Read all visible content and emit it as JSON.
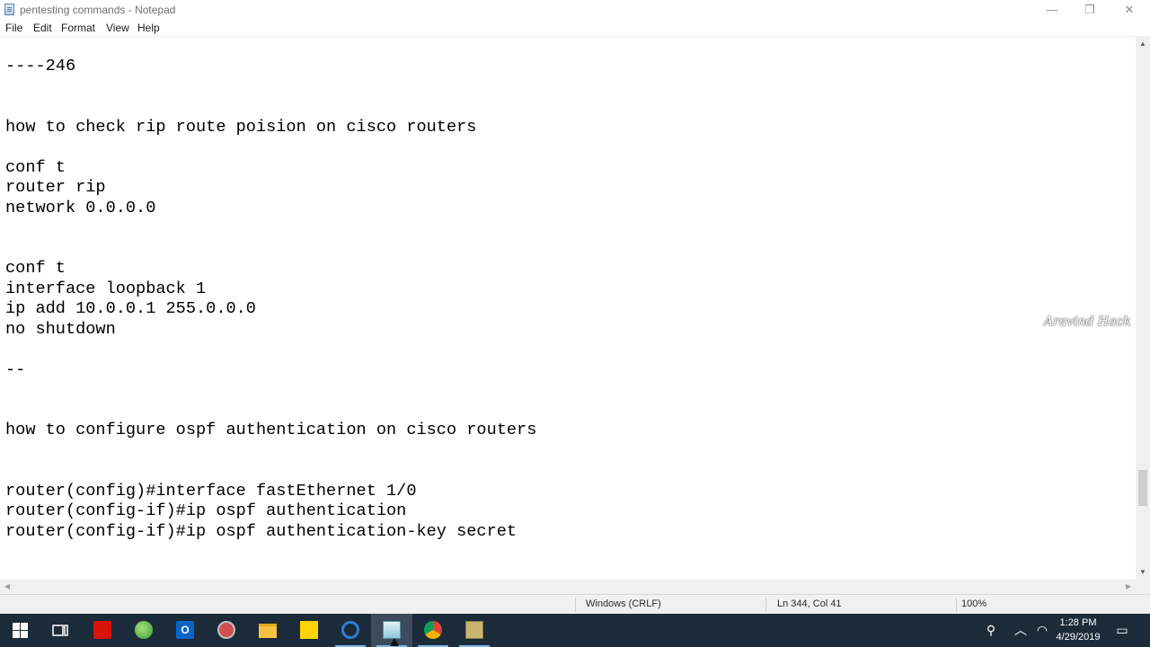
{
  "window": {
    "title": "pentesting commands - Notepad",
    "controls": {
      "minimize": "—",
      "restore": "❐",
      "close": "✕"
    }
  },
  "menu": [
    "File",
    "Edit",
    "Format",
    "View",
    "Help"
  ],
  "editor": {
    "lines": [
      "----246",
      "how to check rip route poision on cisco routers",
      "conf t",
      "router rip",
      "network 0.0.0.0",
      "conf t",
      "interface loopback 1",
      "ip add 10.0.0.1 255.0.0.0",
      "no shutdown",
      "--",
      "how to configure ospf authentication on cisco routers",
      "router(config)#interface fastEthernet 1/0",
      "router(config-if)#ip ospf authentication",
      "router(config-if)#ip ospf authentication-key secret"
    ]
  },
  "watermark": "Aravind Hack",
  "statusbar": {
    "line_ending": "Windows (CRLF)",
    "cursor_position": "Ln 344, Col 41",
    "zoom": "100%"
  },
  "taskbar": {
    "apps": [
      {
        "icon": "task-view-icon"
      },
      {
        "icon": "acrobat-icon",
        "color": "#d7140a"
      },
      {
        "icon": "globe-icon",
        "color": "#4caf50"
      },
      {
        "icon": "outlook-icon",
        "color": "#0a64c8"
      },
      {
        "icon": "network-tool-icon",
        "color": "#c0c0c0"
      },
      {
        "icon": "file-explorer-icon",
        "color": "#f5c342"
      },
      {
        "icon": "sticky-notes-icon",
        "color": "#ffd400"
      },
      {
        "icon": "edge-browser-icon",
        "color": "#2d7dd2"
      },
      {
        "icon": "notepad-icon",
        "color": "#9ad0e0"
      },
      {
        "icon": "chrome-icon",
        "color": "#db4437"
      },
      {
        "icon": "control-panel-icon",
        "color": "#c8b46e"
      }
    ],
    "clock_time": "1:28 PM",
    "clock_date": "4/29/2019"
  },
  "colors": {
    "taskbar": "#1c2b3a",
    "taskbar_active": "#3c4c5c",
    "accent_underline": "#76b9ed"
  }
}
